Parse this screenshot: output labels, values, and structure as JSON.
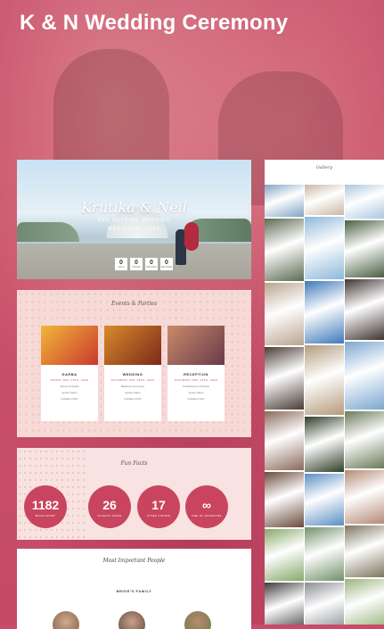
{
  "page": {
    "title": "K & N Wedding Ceremony"
  },
  "hero": {
    "names": "Krutika & Neil",
    "subtitle": "ARE GETTING MARRIED",
    "date": "MAY 17TH, 2020",
    "countdown": [
      {
        "value": "0",
        "label": "DAYS"
      },
      {
        "value": "0",
        "label": "HOURS"
      },
      {
        "value": "0",
        "label": "MINUTES"
      },
      {
        "value": "0",
        "label": "SECONDS"
      }
    ]
  },
  "events": {
    "heading": "Events & Parties",
    "items": [
      {
        "name": "GARBA",
        "when": "FRIDAY MAY 15TH, 2020",
        "l1": "Dinner & Garba",
        "l2": "Venue Name",
        "l3": "Invitation Only",
        "colors": [
          "#f2b63a",
          "#c9392f"
        ]
      },
      {
        "name": "WEDDING",
        "when": "SATURDAY MAY 16TH, 2020",
        "l1": "Baraat & Ceremony",
        "l2": "Venue Name",
        "l3": "Invitation Only",
        "colors": [
          "#d98a2a",
          "#7a2a1a"
        ]
      },
      {
        "name": "RECEPTION",
        "when": "SATURDAY MAY 16TH, 2020",
        "l1": "Cocktail Hour & Dinner",
        "l2": "Venue Name",
        "l3": "Invitation Only",
        "colors": [
          "#c98a6a",
          "#6a3a4a"
        ]
      }
    ]
  },
  "facts": {
    "heading": "Fun Facts",
    "items": [
      {
        "value": "1182",
        "label": "MILES APART"
      },
      {
        "value": "26",
        "label": "FLIGHTS TAKEN"
      },
      {
        "value": "17",
        "label": "CITIES VISITED"
      },
      {
        "value": "∞",
        "label": "ONE OF FAVORITES"
      }
    ]
  },
  "people": {
    "heading": "Most Important People",
    "subheading": "BRIDE'S FAMILY"
  },
  "gallery": {
    "heading": "Gallery",
    "tiles": [
      {
        "c": "#7fa5c4"
      },
      {
        "c": "#5c6b52"
      },
      {
        "c": "#b9a58f"
      },
      {
        "c": "#4a3c36"
      },
      {
        "c": "#8a6a5a"
      },
      {
        "c": "#6a4a3a"
      },
      {
        "c": "#86a86a"
      },
      {
        "c": "#3d3a3a"
      },
      {
        "c": "#c9b7a3"
      },
      {
        "c": "#8db8d9"
      },
      {
        "c": "#3f78b9"
      },
      {
        "c": "#b49b7c"
      },
      {
        "c": "#2e3d28"
      },
      {
        "c": "#5a8fc4"
      },
      {
        "c": "#71906a"
      },
      {
        "c": "#8a8c93"
      },
      {
        "c": "#a9c7de"
      },
      {
        "c": "#4a5f43"
      },
      {
        "c": "#403532"
      },
      {
        "c": "#7ca6cf"
      },
      {
        "c": "#6a7b5a"
      },
      {
        "c": "#b58a76"
      },
      {
        "c": "#7d7560"
      },
      {
        "c": "#9ab27c"
      }
    ]
  }
}
